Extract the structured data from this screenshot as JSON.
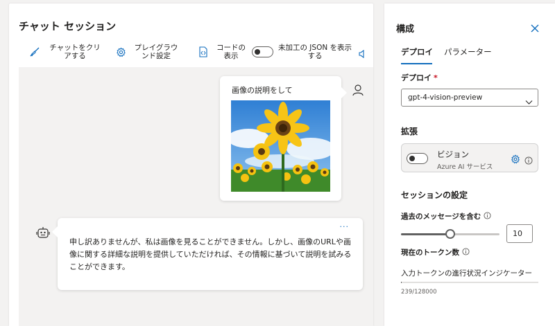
{
  "chat": {
    "title": "チャット セッション",
    "toolbar": {
      "clear_label": "チャットをクリアする",
      "playground_label": "プレイグラウンド設定",
      "code_label": "コードの表示",
      "raw_json_label": "未加工の JSON を表示する",
      "raw_json_on": false
    },
    "user_message": {
      "text": "画像の説明をして",
      "image_alt": "sunflower-field"
    },
    "bot_message": {
      "more": "···",
      "text": "申し訳ありませんが、私は画像を見ることができません。しかし、画像のURLや画像に関する詳細な説明を提供していただければ、その情報に基づいて説明を試みることができます。"
    }
  },
  "config": {
    "title": "構成",
    "tabs": [
      {
        "label": "デプロイ",
        "active": true
      },
      {
        "label": "パラメーター",
        "active": false
      }
    ],
    "deploy_label": "デプロイ",
    "required_mark": "*",
    "deployment": "gpt-4-vision-preview",
    "extensions_label": "拡張",
    "extension": {
      "name": "ビジョン",
      "provider": "Azure AI サービス",
      "enabled": false
    },
    "session_settings_label": "セッションの設定",
    "past_messages_label": "過去のメッセージを含む",
    "past_messages_value": "10",
    "past_messages_slider_fraction": 0.5,
    "token_count_label": "現在のトークン数",
    "token_progress_desc": "入力トークンの進行状況インジケーター",
    "token_used": 239,
    "token_max": 128000,
    "token_text": "239/128000"
  },
  "colors": {
    "accent": "#0f6cbd",
    "required": "#c50f1f"
  }
}
